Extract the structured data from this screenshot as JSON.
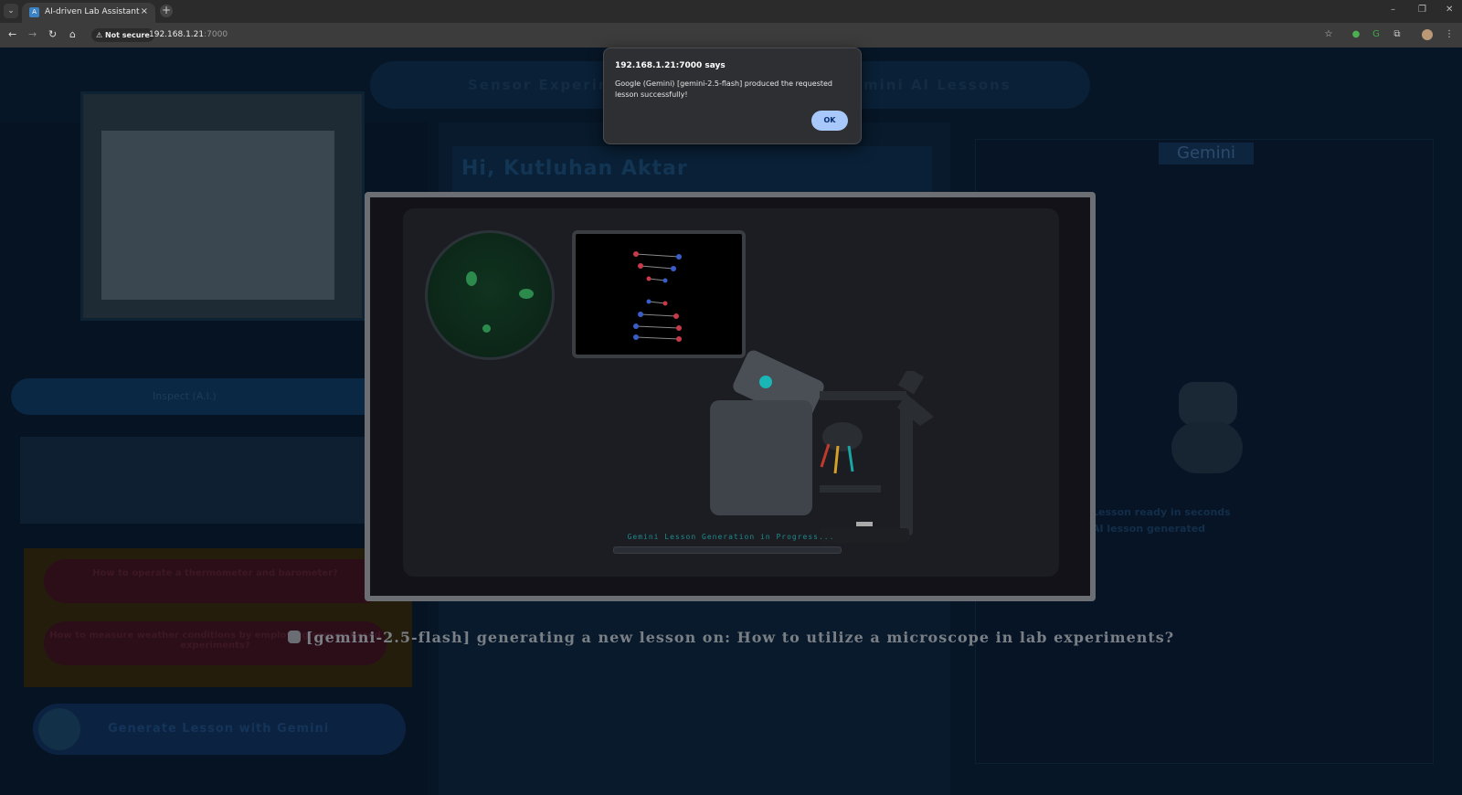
{
  "browser": {
    "tab_title": "AI-driven Lab Assistant",
    "tab_close": "×",
    "new_tab": "+",
    "security_label": "⚠ Not secure",
    "url_host": "192.168.1.21",
    "url_port": ":7000",
    "win_minimize": "–",
    "win_restore": "❐",
    "win_close": "✕"
  },
  "app": {
    "banner_left": "Sensor Experime",
    "banner_right": "mini AI Lessons",
    "greeting": "Hi, Kutluhan Aktar",
    "inspect_label": "Inspect (A.I.)",
    "option_1": "How to operate a thermometer and barometer?",
    "option_2": "How to measure weather conditions by employing sensor-based experiments?",
    "generate_button": "Generate Lesson with Gemini",
    "gemini_logo": "Gemini",
    "right_line_1": "Lesson ready in seconds",
    "right_line_2": "AI lesson generated"
  },
  "modal": {
    "progress_label": "Gemini Lesson Generation in Progress...",
    "status_line": "[gemini-2.5-flash] generating a new lesson on: How to utilize a microscope in lab experiments?"
  },
  "alert": {
    "heading": "192.168.1.21:7000 says",
    "message": "Google (Gemini) [gemini-2.5-flash] produced the requested lesson successfully!",
    "ok_label": "OK"
  }
}
